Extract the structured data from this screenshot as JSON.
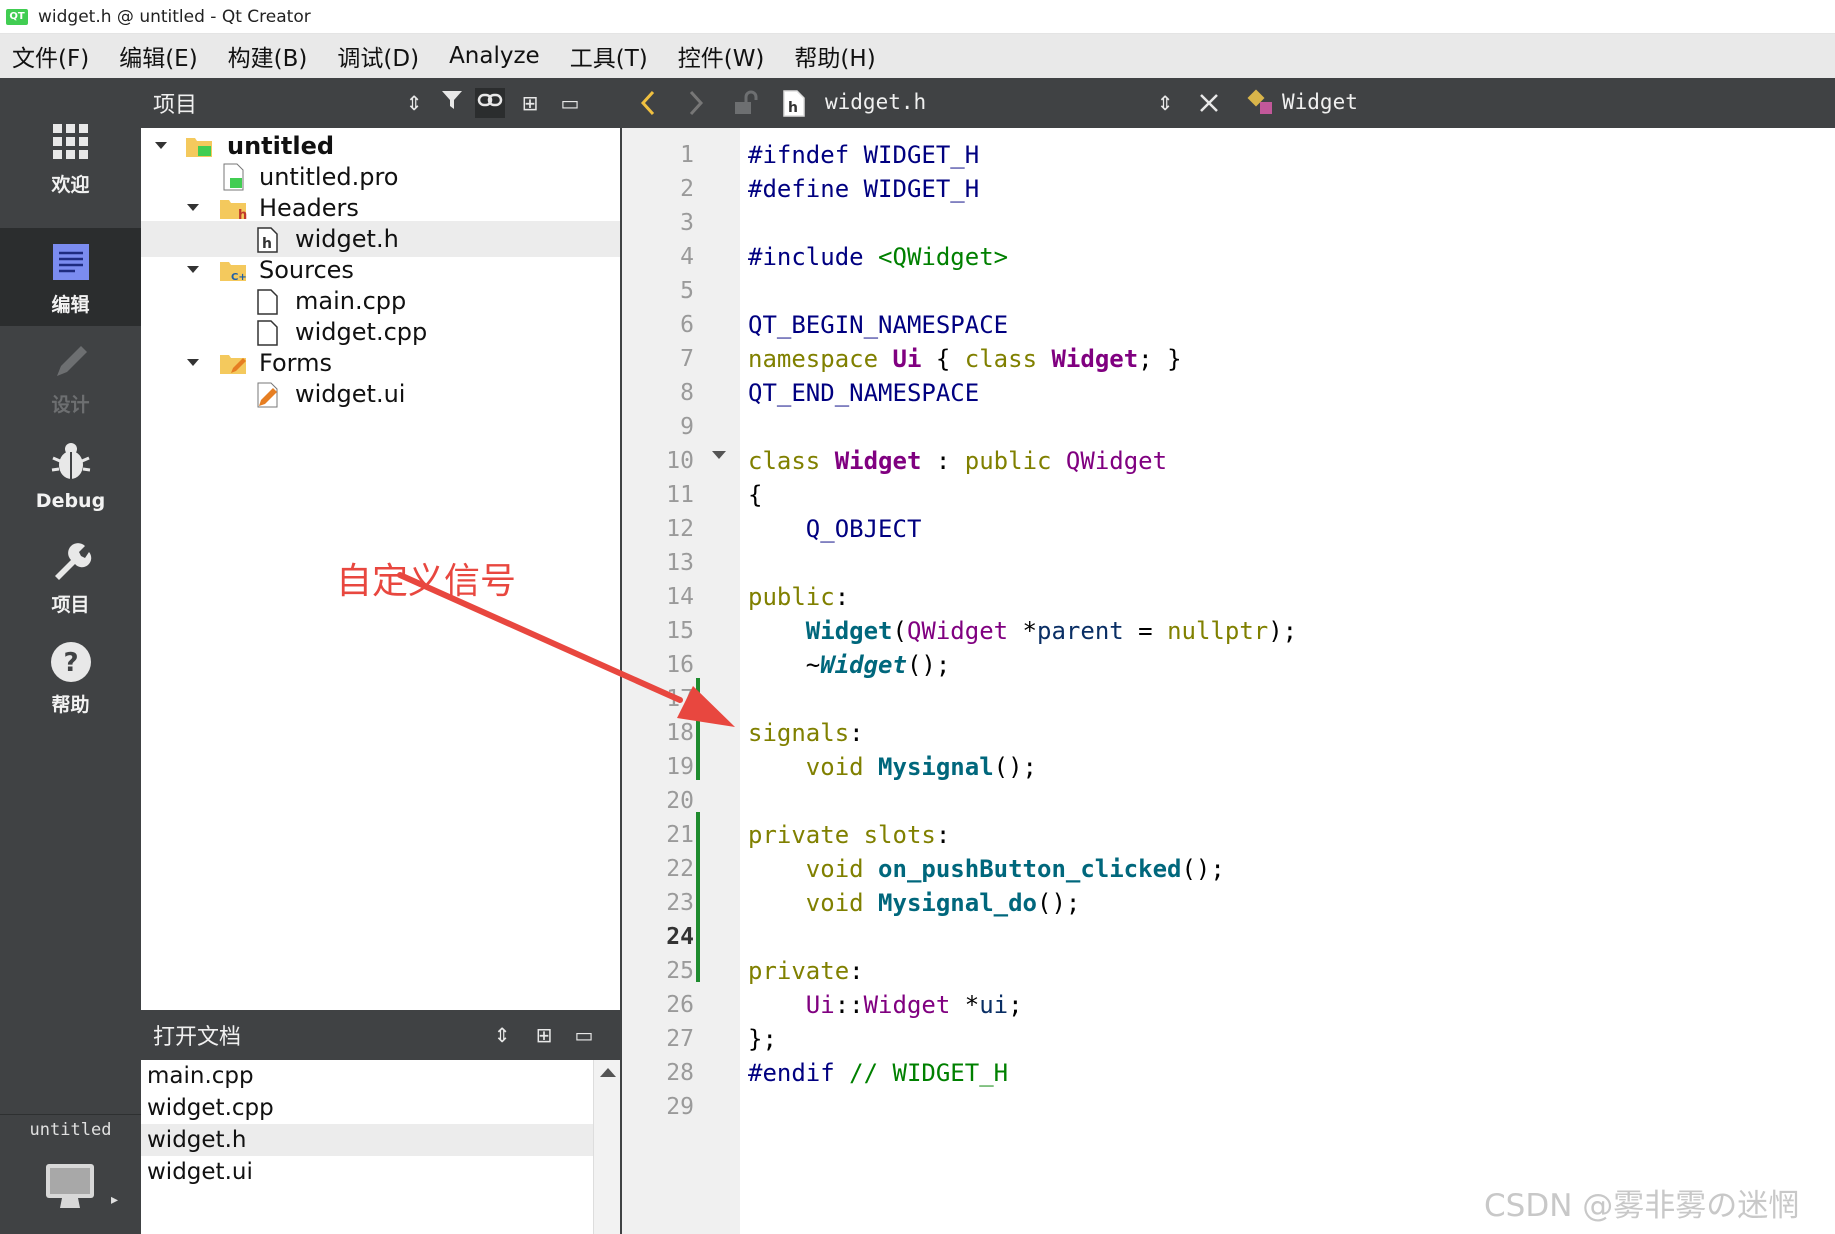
{
  "window": {
    "title": "widget.h @ untitled - Qt Creator",
    "logo_text": "QT"
  },
  "menubar": {
    "items": [
      "文件(F)",
      "编辑(E)",
      "构建(B)",
      "调试(D)",
      "Analyze",
      "工具(T)",
      "控件(W)",
      "帮助(H)"
    ]
  },
  "modebar": {
    "modes": [
      {
        "label": "欢迎",
        "icon": "welcome-grid-icon"
      },
      {
        "label": "编辑",
        "icon": "edit-document-icon"
      },
      {
        "label": "设计",
        "icon": "design-pencil-icon"
      },
      {
        "label": "Debug",
        "icon": "debug-bug-icon"
      },
      {
        "label": "项目",
        "icon": "projects-wrench-icon"
      },
      {
        "label": "帮助",
        "icon": "help-question-icon"
      }
    ],
    "kit_label": "untitled",
    "kit_icon": "monitor-icon"
  },
  "project_panel": {
    "title": "项目",
    "tree": [
      {
        "label": "untitled",
        "icon": "qt-project-folder-icon",
        "expanded": true
      },
      {
        "label": "untitled.pro",
        "icon": "pro-file-icon"
      },
      {
        "label": "Headers",
        "icon": "headers-folder-icon",
        "expanded": true
      },
      {
        "label": "widget.h",
        "icon": "header-file-icon",
        "selected": true
      },
      {
        "label": "Sources",
        "icon": "sources-folder-icon",
        "expanded": true
      },
      {
        "label": "main.cpp",
        "icon": "cpp-file-icon"
      },
      {
        "label": "widget.cpp",
        "icon": "cpp-file-icon"
      },
      {
        "label": "Forms",
        "icon": "forms-folder-icon",
        "expanded": true
      },
      {
        "label": "widget.ui",
        "icon": "ui-file-icon"
      }
    ]
  },
  "open_documents": {
    "title": "打开文档",
    "items": [
      "main.cpp",
      "widget.cpp",
      "widget.h",
      "widget.ui"
    ],
    "selected": "widget.h"
  },
  "editor_toolbar": {
    "file": "widget.h",
    "symbol": "Widget"
  },
  "editor": {
    "current_line": 24,
    "lines": [
      "#ifndef WIDGET_H",
      "#define WIDGET_H",
      "",
      "#include <QWidget>",
      "",
      "QT_BEGIN_NAMESPACE",
      "namespace Ui { class Widget; }",
      "QT_END_NAMESPACE",
      "",
      "class Widget : public QWidget",
      "{",
      "    Q_OBJECT",
      "",
      "public:",
      "    Widget(QWidget *parent = nullptr);",
      "    ~Widget();",
      "",
      "signals:",
      "    void Mysignal();",
      "",
      "private slots:",
      "    void on_pushButton_clicked();",
      "    void Mysignal_do();",
      "",
      "private:",
      "    Ui::Widget *ui;",
      "};",
      "#endif // WIDGET_H",
      ""
    ]
  },
  "annotation": {
    "text": "自定义信号",
    "color": "#e8473f"
  },
  "watermark": "CSDN @雾非雾の迷惘",
  "colors": {
    "sidebar_bg": "#404244",
    "active_mode_bg": "#2b2d2e",
    "change_bar": "#1e8b2e"
  }
}
